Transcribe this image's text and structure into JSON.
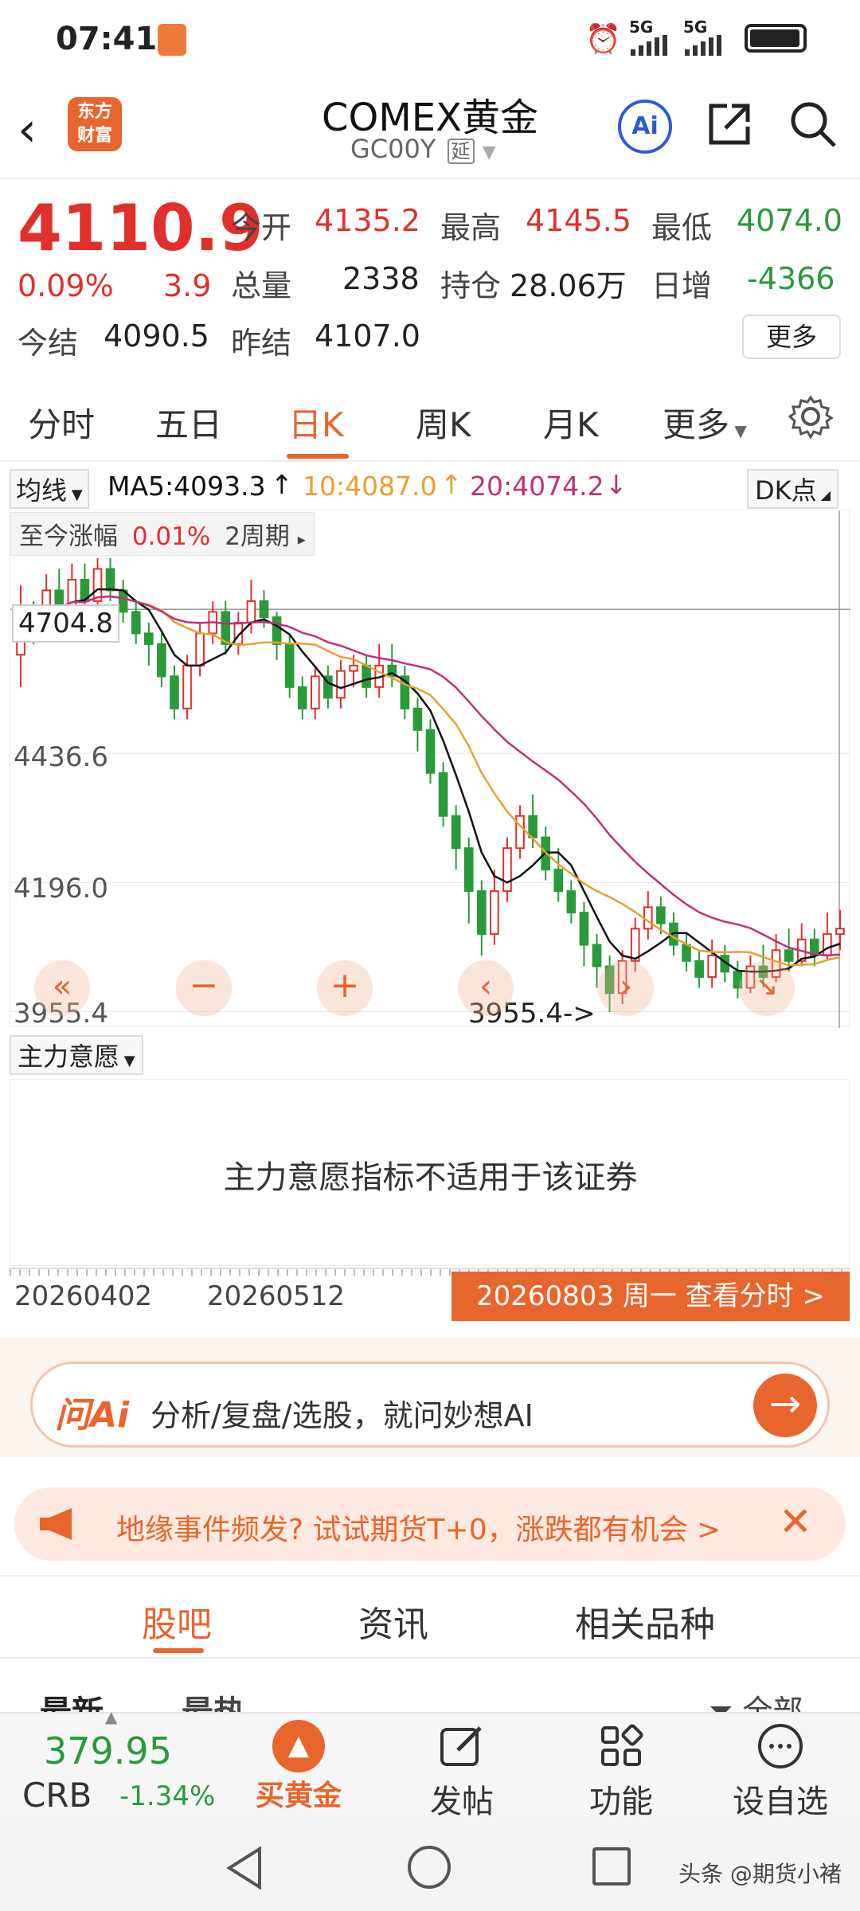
{
  "status": {
    "time": "07:41",
    "net1": "5G",
    "net2": "5G"
  },
  "header": {
    "logo_line1": "东方",
    "logo_line2": "财富",
    "title": "COMEX黄金",
    "code": "GC00Y",
    "delay_badge": "延",
    "ai_label": "Ai"
  },
  "quote": {
    "price": "4110.9",
    "pct": "0.09%",
    "change": "3.9",
    "open_label": "今开",
    "open": "4135.2",
    "high_label": "最高",
    "high": "4145.5",
    "low_label": "最低",
    "low": "4074.0",
    "vol_label": "总量",
    "vol": "2338",
    "oi_label": "持仓",
    "oi": "28.06万",
    "daychg_label": "日增",
    "daychg": "-4366",
    "settle_label": "今结",
    "settle": "4090.5",
    "prev_label": "昨结",
    "prev": "4107.0",
    "more": "更多"
  },
  "tabs": [
    "分时",
    "五日",
    "日K",
    "周K",
    "月K",
    "更多"
  ],
  "ma": {
    "selector": "均线",
    "ma5": "MA5:4093.3",
    "ma10": "10:4087.0",
    "ma20": "20:4074.2",
    "dk": "DK点",
    "colors": {
      "ma5": "#111111",
      "ma10": "#e8a030",
      "ma20": "#c0307a",
      "up": "#e0302c",
      "down": "#2a9a3a"
    }
  },
  "chart_panel": {
    "range_label": "至今涨幅",
    "range_value": "0.01%",
    "range_period": "2周期",
    "crosshair_value": "4704.8",
    "y_ticks": [
      "4436.6",
      "4196.0",
      "3955.4"
    ],
    "low_marker": "3955.4->"
  },
  "chart_data": {
    "type": "candlestick",
    "y_min": 3955.4,
    "y_ticks": [
      4436.6,
      4196.0,
      3955.4
    ],
    "x_labels": [
      "20260402",
      "20260512"
    ],
    "candles": [
      [
        4620,
        4700,
        4560,
        4750
      ],
      [
        4700,
        4680,
        4640,
        4720
      ],
      [
        4680,
        4740,
        4650,
        4770
      ],
      [
        4740,
        4710,
        4690,
        4780
      ],
      [
        4710,
        4760,
        4690,
        4790
      ],
      [
        4760,
        4720,
        4700,
        4790
      ],
      [
        4720,
        4780,
        4700,
        4800
      ],
      [
        4780,
        4740,
        4720,
        4800
      ],
      [
        4740,
        4700,
        4680,
        4760
      ],
      [
        4700,
        4660,
        4640,
        4720
      ],
      [
        4660,
        4640,
        4600,
        4680
      ],
      [
        4640,
        4580,
        4560,
        4660
      ],
      [
        4580,
        4520,
        4500,
        4600
      ],
      [
        4520,
        4600,
        4500,
        4620
      ],
      [
        4600,
        4660,
        4580,
        4680
      ],
      [
        4660,
        4700,
        4640,
        4720
      ],
      [
        4700,
        4640,
        4620,
        4720
      ],
      [
        4640,
        4680,
        4620,
        4700
      ],
      [
        4680,
        4720,
        4660,
        4760
      ],
      [
        4720,
        4690,
        4670,
        4740
      ],
      [
        4690,
        4640,
        4610,
        4700
      ],
      [
        4640,
        4560,
        4540,
        4660
      ],
      [
        4560,
        4520,
        4500,
        4580
      ],
      [
        4520,
        4580,
        4500,
        4600
      ],
      [
        4580,
        4540,
        4520,
        4600
      ],
      [
        4540,
        4590,
        4520,
        4610
      ],
      [
        4590,
        4600,
        4560,
        4620
      ],
      [
        4600,
        4560,
        4540,
        4620
      ],
      [
        4560,
        4600,
        4540,
        4640
      ],
      [
        4600,
        4580,
        4560,
        4640
      ],
      [
        4580,
        4520,
        4500,
        4600
      ],
      [
        4520,
        4480,
        4440,
        4540
      ],
      [
        4480,
        4400,
        4380,
        4500
      ],
      [
        4400,
        4320,
        4300,
        4420
      ],
      [
        4320,
        4260,
        4220,
        4340
      ],
      [
        4260,
        4180,
        4120,
        4280
      ],
      [
        4180,
        4100,
        4060,
        4200
      ],
      [
        4100,
        4180,
        4080,
        4220
      ],
      [
        4180,
        4260,
        4160,
        4280
      ],
      [
        4260,
        4320,
        4240,
        4340
      ],
      [
        4320,
        4280,
        4260,
        4360
      ],
      [
        4280,
        4220,
        4200,
        4300
      ],
      [
        4220,
        4180,
        4160,
        4260
      ],
      [
        4180,
        4140,
        4120,
        4200
      ],
      [
        4140,
        4080,
        4040,
        4160
      ],
      [
        4080,
        4040,
        4000,
        4100
      ],
      [
        4040,
        3990,
        3955,
        4060
      ],
      [
        3990,
        4050,
        3970,
        4070
      ],
      [
        4050,
        4110,
        4030,
        4130
      ],
      [
        4110,
        4150,
        4090,
        4180
      ],
      [
        4150,
        4120,
        4100,
        4170
      ],
      [
        4120,
        4080,
        4060,
        4140
      ],
      [
        4080,
        4050,
        4030,
        4100
      ],
      [
        4050,
        4020,
        4000,
        4070
      ],
      [
        4020,
        4060,
        4000,
        4090
      ],
      [
        4060,
        4030,
        4010,
        4080
      ],
      [
        4030,
        4000,
        3980,
        4050
      ],
      [
        4000,
        4040,
        3990,
        4060
      ],
      [
        4040,
        4020,
        4000,
        4080
      ],
      [
        4020,
        4070,
        4010,
        4100
      ],
      [
        4070,
        4050,
        4030,
        4110
      ],
      [
        4050,
        4090,
        4040,
        4120
      ],
      [
        4090,
        4060,
        4040,
        4110
      ],
      [
        4060,
        4100,
        4050,
        4140
      ],
      [
        4100,
        4110,
        4070,
        4145
      ]
    ]
  },
  "indicator": {
    "selector": "主力意愿",
    "message": "主力意愿指标不适用于该证券"
  },
  "dates": {
    "d1": "20260402",
    "d2": "20260512",
    "selected": "20260803 周一 查看分时 >"
  },
  "ai_bar": {
    "brand": "问Ai",
    "prompt": "分析/复盘/选股，就问妙想AI"
  },
  "banner": {
    "text": "地缘事件频发? 试试期货T+0，涨跌都有机会 >"
  },
  "content_tabs": [
    "股吧",
    "资讯",
    "相关品种"
  ],
  "sort": {
    "latest": "最新",
    "hot": "最热",
    "filter": "全部"
  },
  "bottom": {
    "crb_value": "379.95",
    "crb_label": "CRB",
    "crb_change": "-1.34%",
    "buy_gold": "买黄金",
    "post": "发帖",
    "func": "功能",
    "watch": "设自选"
  },
  "watermark": "头条 @期货小褚"
}
